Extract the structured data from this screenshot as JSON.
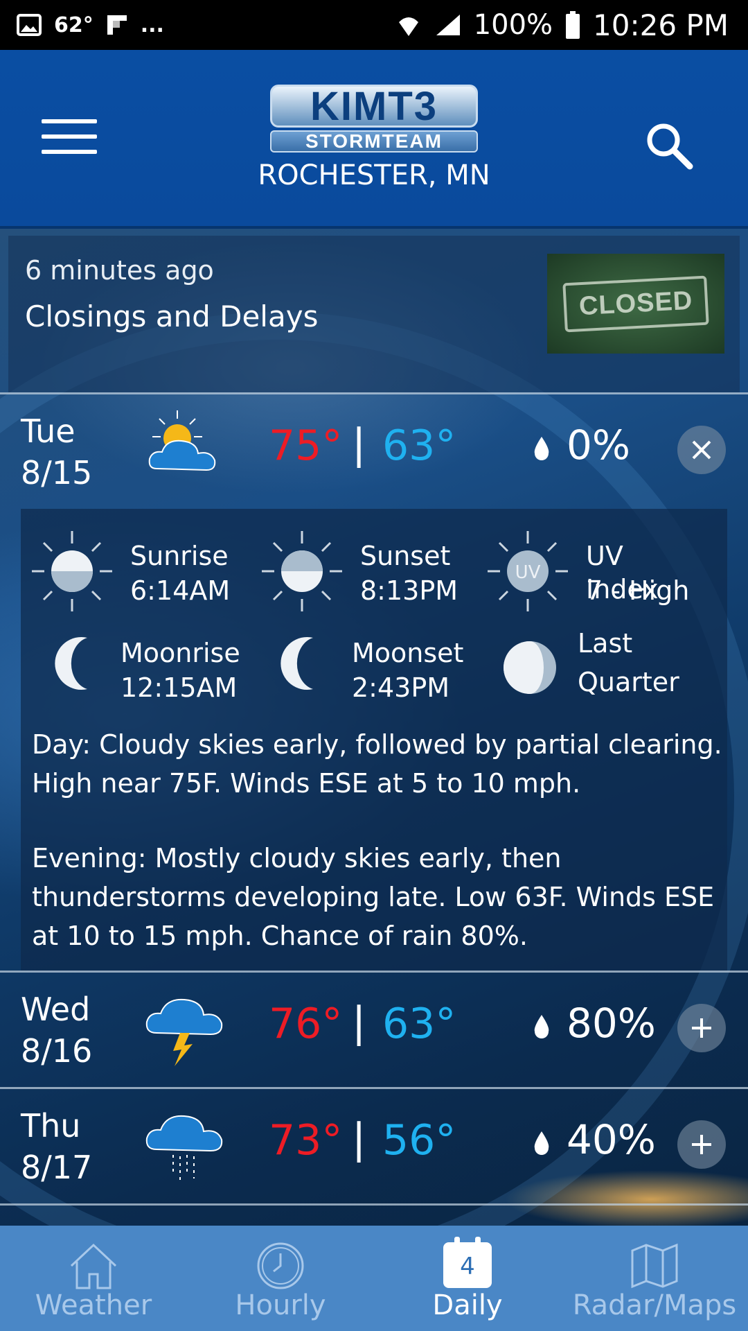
{
  "status_bar": {
    "temperature": "62°",
    "extra": "...",
    "battery": "100%",
    "time": "10:26 PM"
  },
  "header": {
    "logo_main": "KIMT3",
    "logo_sub": "STORMTEAM",
    "location": "ROCHESTER, MN"
  },
  "news": {
    "time_ago": "6 minutes ago",
    "title": "Closings and Delays",
    "thumbnail_text": "CLOSED"
  },
  "days": [
    {
      "day": "Tue",
      "date": "8/15",
      "icon": "partly-sunny-icon",
      "high": "75°",
      "separator": "|",
      "low": "63°",
      "precip": "0%",
      "expanded": true
    },
    {
      "day": "Wed",
      "date": "8/16",
      "icon": "thunderstorm-icon",
      "high": "76°",
      "separator": "|",
      "low": "63°",
      "precip": "80%",
      "expanded": false
    },
    {
      "day": "Thu",
      "date": "8/17",
      "icon": "rain-cloud-icon",
      "high": "73°",
      "separator": "|",
      "low": "56°",
      "precip": "40%",
      "expanded": false
    }
  ],
  "details": {
    "sunrise_label": "Sunrise",
    "sunrise_value": "6:14AM",
    "sunset_label": "Sunset",
    "sunset_value": "8:13PM",
    "uv_label": "UV Index",
    "uv_value": "7 - High",
    "uv_icon_text": "UV",
    "moonrise_label": "Moonrise",
    "moonrise_value": "12:15AM",
    "moonset_label": "Moonset",
    "moonset_value": "2:43PM",
    "phase_label": "Last",
    "phase_value": "Quarter",
    "day_text": "Day: Cloudy skies early, followed by partial clearing. High near 75F. Winds ESE at 5 to 10 mph.",
    "evening_text": "Evening: Mostly cloudy skies early, then thunderstorms developing late. Low 63F. Winds ESE at 10 to 15 mph. Chance of rain 80%."
  },
  "nav": {
    "weather": "Weather",
    "hourly": "Hourly",
    "daily": "Daily",
    "daily_badge": "4",
    "radar": "Radar/Maps",
    "active": "Daily"
  },
  "colors": {
    "header": "#0a4ea3",
    "high_temp": "#ee1c25",
    "low_temp": "#1fb1f0",
    "nav_bg": "#4a87c6"
  }
}
